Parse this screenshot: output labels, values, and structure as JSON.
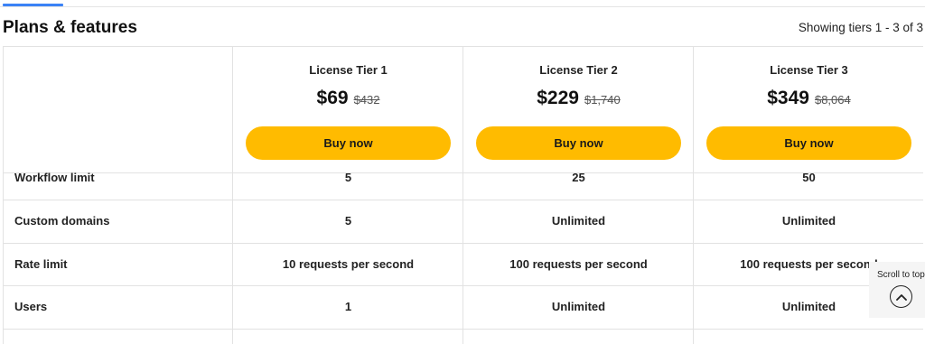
{
  "header": {
    "title": "Plans & features",
    "tier_count": "Showing tiers 1 - 3 of 3"
  },
  "tiers": [
    {
      "name": "License Tier 1",
      "price": "$69",
      "old_price": "$432",
      "button": "Buy now"
    },
    {
      "name": "License Tier 2",
      "price": "$229",
      "old_price": "$1,740",
      "button": "Buy now"
    },
    {
      "name": "License Tier 3",
      "price": "$349",
      "old_price": "$8,064",
      "button": "Buy now"
    }
  ],
  "features": [
    {
      "label": "Workflow limit",
      "values": [
        "5",
        "25",
        "50"
      ]
    },
    {
      "label": "Custom domains",
      "values": [
        "5",
        "Unlimited",
        "Unlimited"
      ]
    },
    {
      "label": "Rate limit",
      "values": [
        "10 requests per second",
        "100 requests per second",
        "100 requests per second"
      ]
    },
    {
      "label": "Users",
      "values": [
        "1",
        "Unlimited",
        "Unlimited"
      ]
    }
  ],
  "scroll_to_top": {
    "label": "Scroll to top",
    "icon": "chevron-up-icon"
  },
  "colors": {
    "accent": "#ffbb00",
    "tab_indicator": "#3b82f6",
    "border": "#e2e2e2"
  }
}
